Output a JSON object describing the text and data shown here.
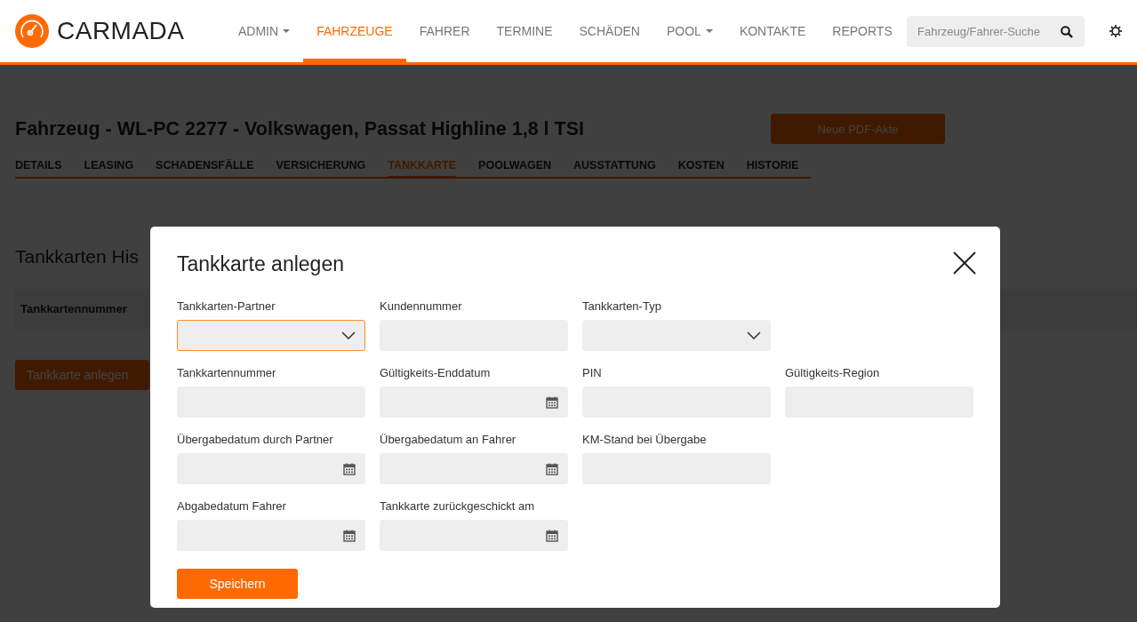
{
  "header": {
    "logo": "CARMADA",
    "nav": [
      {
        "label": "ADMIN",
        "dropdown": true,
        "selected": false
      },
      {
        "label": "FAHRZEUGE",
        "dropdown": false,
        "selected": true
      },
      {
        "label": "FAHRER",
        "dropdown": false,
        "selected": false
      },
      {
        "label": "TERMINE",
        "dropdown": false,
        "selected": false
      },
      {
        "label": "SCHÄDEN",
        "dropdown": false,
        "selected": false
      },
      {
        "label": "POOL",
        "dropdown": true,
        "selected": false
      },
      {
        "label": "KONTAKTE",
        "dropdown": false,
        "selected": false
      },
      {
        "label": "REPORTS",
        "dropdown": false,
        "selected": false
      }
    ],
    "search": {
      "placeholder": "Fahrzeug/Fahrer-Suche"
    }
  },
  "page": {
    "title": "Fahrzeug - WL-PC 2277 - Volkswagen, Passat Highline 1,8 l TSI",
    "pdf_button": "Neue PDF-Akte",
    "tabs": [
      {
        "label": "DETAILS",
        "selected": false
      },
      {
        "label": "LEASING",
        "selected": false
      },
      {
        "label": "SCHADENSFÄLLE",
        "selected": false
      },
      {
        "label": "VERSICHERUNG",
        "selected": false
      },
      {
        "label": "TANKKARTE",
        "selected": true
      },
      {
        "label": "POOLWAGEN",
        "selected": false
      },
      {
        "label": "AUSSTATTUNG",
        "selected": false
      },
      {
        "label": "KOSTEN",
        "selected": false
      },
      {
        "label": "HISTORIE",
        "selected": false
      }
    ],
    "section_title": "Tankkarten His",
    "table": {
      "columns": [
        "Tankkartennummer"
      ]
    },
    "add_button": "Tankkarte anlegen"
  },
  "modal": {
    "title": "Tankkarte anlegen",
    "rows": [
      {
        "fields": [
          {
            "label": "Tankkarten-Partner",
            "kind": "select",
            "focused": true
          },
          {
            "label": "Kundennummer",
            "kind": "text",
            "focused": false
          },
          {
            "label": "Tankkarten-Typ",
            "kind": "select",
            "focused": false
          }
        ]
      },
      {
        "fields": [
          {
            "label": "Tankkartennummer",
            "kind": "text",
            "focused": false
          },
          {
            "label": "Gültigkeits-Enddatum",
            "kind": "date",
            "focused": false
          },
          {
            "label": "PIN",
            "kind": "text",
            "focused": false
          },
          {
            "label": "Gültigkeits-Region",
            "kind": "text",
            "focused": false
          }
        ]
      },
      {
        "fields": [
          {
            "label": "Übergabedatum durch Partner",
            "kind": "date",
            "focused": false
          },
          {
            "label": "Übergabedatum an Fahrer",
            "kind": "date",
            "focused": false
          },
          {
            "label": "KM-Stand bei Übergabe",
            "kind": "text",
            "focused": false
          }
        ]
      },
      {
        "fields": [
          {
            "label": "Abgabedatum Fahrer",
            "kind": "date",
            "focused": false
          },
          {
            "label": "Tankkarte zurückgeschickt am",
            "kind": "date",
            "focused": false
          }
        ]
      }
    ],
    "save_button": "Speichern"
  }
}
